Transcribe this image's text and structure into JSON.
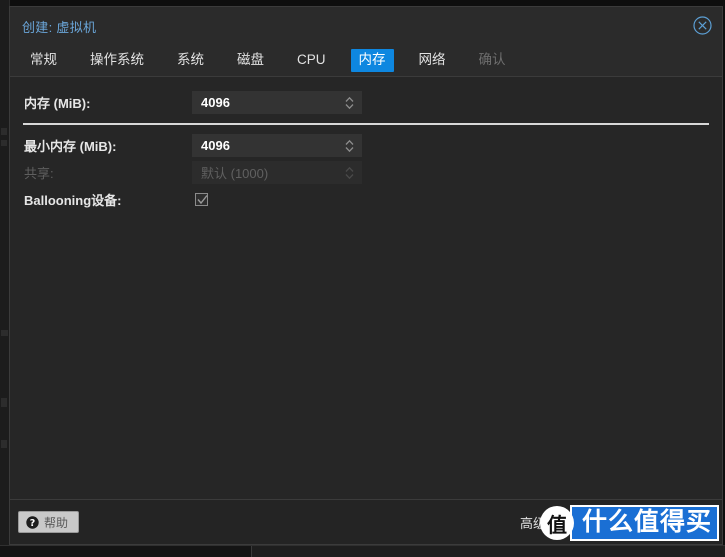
{
  "dialog": {
    "title": "创建: 虚拟机",
    "close_icon": "close-circle-icon"
  },
  "tabs": [
    {
      "label": "常规",
      "state": "normal"
    },
    {
      "label": "操作系统",
      "state": "normal"
    },
    {
      "label": "系统",
      "state": "normal"
    },
    {
      "label": "磁盘",
      "state": "normal"
    },
    {
      "label": "CPU",
      "state": "normal"
    },
    {
      "label": "内存",
      "state": "active"
    },
    {
      "label": "网络",
      "state": "normal"
    },
    {
      "label": "确认",
      "state": "disabled"
    }
  ],
  "form": {
    "memory": {
      "label": "内存 (MiB):",
      "value": "4096",
      "spinner_icon": "spinner-updown-icon"
    },
    "min_memory": {
      "label": "最小内存 (MiB):",
      "value": "4096",
      "spinner_icon": "spinner-updown-icon"
    },
    "shares": {
      "label": "共享:",
      "placeholder": "默认 (1000)",
      "value": "默认 (1000)",
      "spinner_icon": "spinner-updown-icon",
      "disabled": true
    },
    "ballooning": {
      "label": "Ballooning设备:",
      "checked": true,
      "check_icon": "checkmark-icon"
    }
  },
  "footer": {
    "help_label": "帮助",
    "help_icon": "question-circle-icon",
    "advanced_label": "高级"
  },
  "watermark": {
    "badge": "值",
    "text": "什么值得买"
  },
  "colors": {
    "accent": "#0e87e0",
    "title": "#6aa5d8",
    "dialog_bg": "#242424",
    "content_bg": "#262626",
    "header_bg": "#2b2b2b",
    "input_bg": "#333333",
    "divider": "#d8d8d8",
    "watermark_blue": "#1a6fd4"
  }
}
